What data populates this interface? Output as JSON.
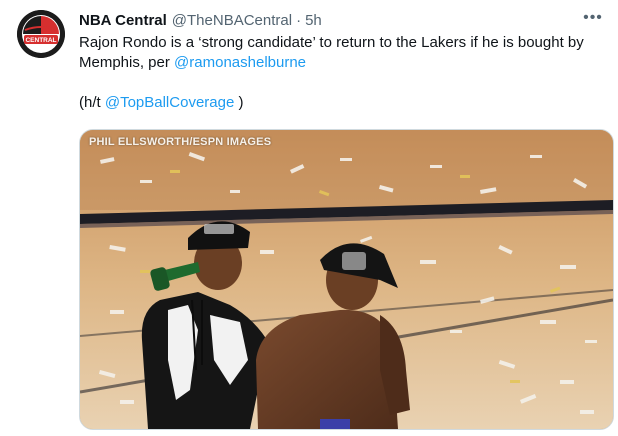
{
  "author": {
    "name": "NBA Central",
    "handle": "@TheNBACentral",
    "separator": "·",
    "time": "5h",
    "avatar_text": "CENTRAL"
  },
  "more_label": "•••",
  "tweet": {
    "text_before_mention": "Rajon Rondo is a ‘strong candidate’ to return to the Lakers if he is bought by Memphis, per ",
    "mention": "@ramonashelburne",
    "ht_prefix": "(h/t ",
    "ht_mention": "@TopBallCoverage",
    "ht_suffix": " )"
  },
  "media": {
    "credit": "PHIL ELLSWORTH/ESPN IMAGES",
    "description_icon": "photo-celebration"
  },
  "colors": {
    "link": "#1d9bf0",
    "secondary_text": "#536471",
    "primary_text": "#0f1419",
    "avatar_red": "#d62f2f"
  }
}
